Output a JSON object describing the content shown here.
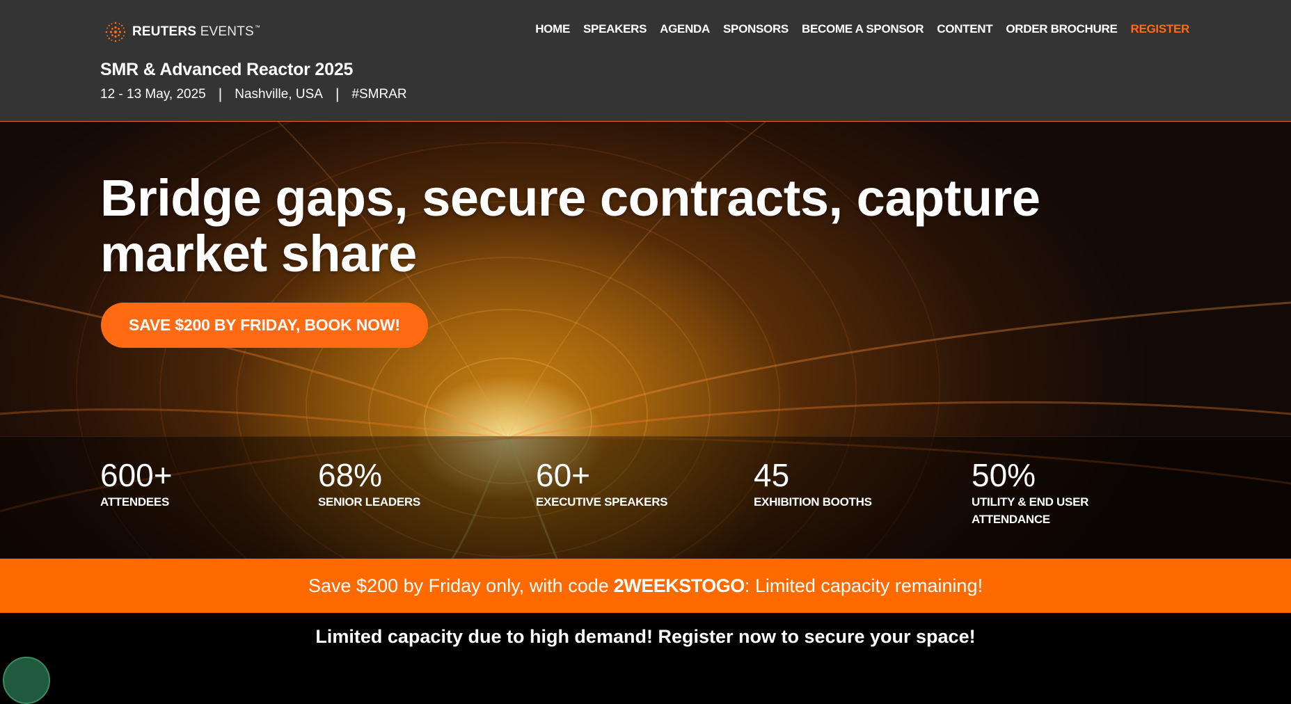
{
  "header": {
    "logo": {
      "brand": "REUTERS",
      "suffix": "EVENTS",
      "trademark": "™",
      "icon": "reuters-dot-logo-icon"
    },
    "nav": [
      {
        "label": "HOME"
      },
      {
        "label": "SPEAKERS"
      },
      {
        "label": "AGENDA"
      },
      {
        "label": "SPONSORS"
      },
      {
        "label": "BECOME A SPONSOR"
      },
      {
        "label": "CONTENT"
      },
      {
        "label": "ORDER BROCHURE"
      },
      {
        "label": "REGISTER",
        "accent": true
      }
    ],
    "event_title": "SMR & Advanced Reactor 2025",
    "event_dates": "12 - 13 May, 2025",
    "event_location": "Nashville, USA",
    "event_hashtag": "#SMRAR",
    "separator": "|"
  },
  "hero": {
    "headline_line1": "Bridge gaps, secure contracts, capture",
    "headline_line2": "market share",
    "cta_label": "SAVE $200 BY FRIDAY, BOOK NOW!",
    "stats": [
      {
        "value": "600+",
        "label": "ATTENDEES"
      },
      {
        "value": "68%",
        "label": "SENIOR LEADERS"
      },
      {
        "value": "60+",
        "label": "EXECUTIVE SPEAKERS"
      },
      {
        "value": "45",
        "label": "EXHIBITION BOOTHS"
      },
      {
        "value": "50%",
        "label_line1": "UTILITY & END USER",
        "label_line2": "ATTENDANCE"
      }
    ]
  },
  "promo_bar": {
    "text_before": "Save $200 by Friday only, with code",
    "code": "2WEEKSTOGO",
    "text_after": ": Limited capacity remaining!"
  },
  "capacity_bar": {
    "text": "Limited capacity due to high demand! Register now to secure your space!"
  },
  "colors": {
    "header_bg": "#343434",
    "accent_orange": "#ff6a13",
    "promo_orange": "#ff6a00",
    "capacity_bg": "#000000"
  },
  "chat_widget": {
    "icon": "chat-bubble-icon"
  }
}
